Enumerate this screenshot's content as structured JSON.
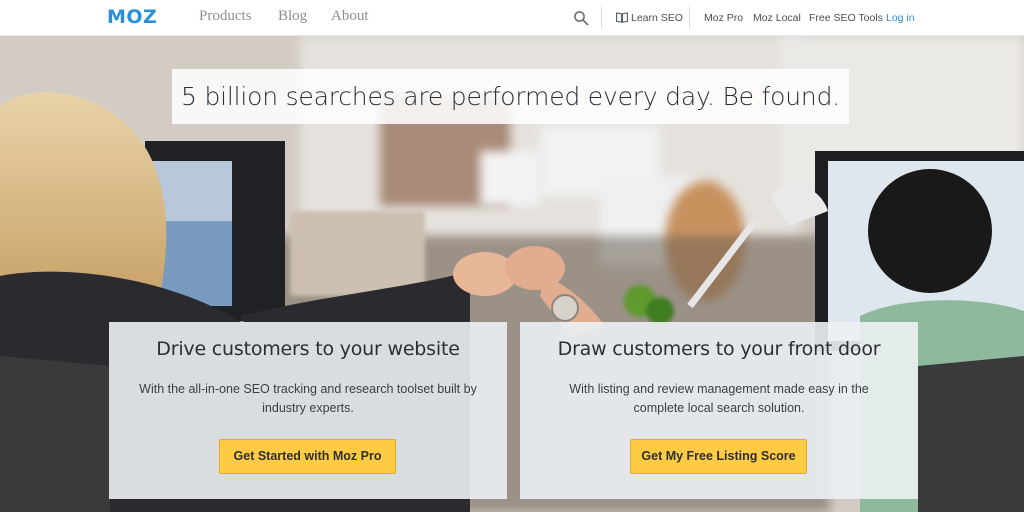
{
  "brand": {
    "logo": "MOZ",
    "accent": "#2c8fdc",
    "button_color": "#ffcb45"
  },
  "nav": {
    "main": [
      "Products",
      "Blog",
      "About"
    ],
    "search_icon": "search-icon",
    "learn_icon": "book-icon",
    "right": {
      "learn_seo": "Learn SEO",
      "moz_pro": "Moz Pro",
      "moz_local": "Moz Local",
      "free_tools": "Free SEO Tools",
      "login": "Log in"
    }
  },
  "hero": {
    "headline": "5 billion searches are performed every day. Be found.",
    "cards": [
      {
        "title": "Drive customers to your website",
        "description": "With the all-in-one SEO tracking and research toolset built by industry experts.",
        "button": "Get Started with Moz Pro"
      },
      {
        "title": "Draw customers to your front door",
        "description": "With listing and review management made easy in the complete local search solution.",
        "button": "Get My Free Listing Score"
      }
    ]
  }
}
